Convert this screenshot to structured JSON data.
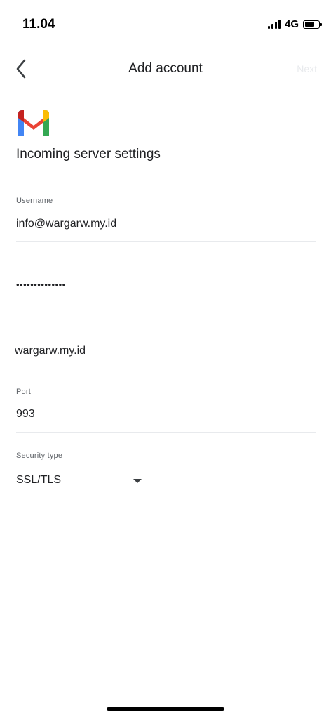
{
  "status_bar": {
    "time": "11.04",
    "network": "4G",
    "battery_level": 0.75
  },
  "app_bar": {
    "title": "Add account",
    "next_label": "Next",
    "back_icon": "chevron-left-icon"
  },
  "logo_icon": "gmail-logo",
  "heading": "Incoming server settings",
  "fields": {
    "username": {
      "label": "Username",
      "value": "info@wargarw.my.id"
    },
    "password": {
      "value": "••••••••••••••"
    },
    "server": {
      "value": "wargarw.my.id"
    },
    "port": {
      "label": "Port",
      "value": "993"
    },
    "security": {
      "label": "Security type",
      "value": "SSL/TLS"
    }
  },
  "colors": {
    "gmail_red": "#EA4335",
    "gmail_blue": "#4285F4",
    "gmail_green": "#34A853",
    "gmail_yellow": "#FBBC04",
    "gmail_dark_red": "#C5221F"
  }
}
